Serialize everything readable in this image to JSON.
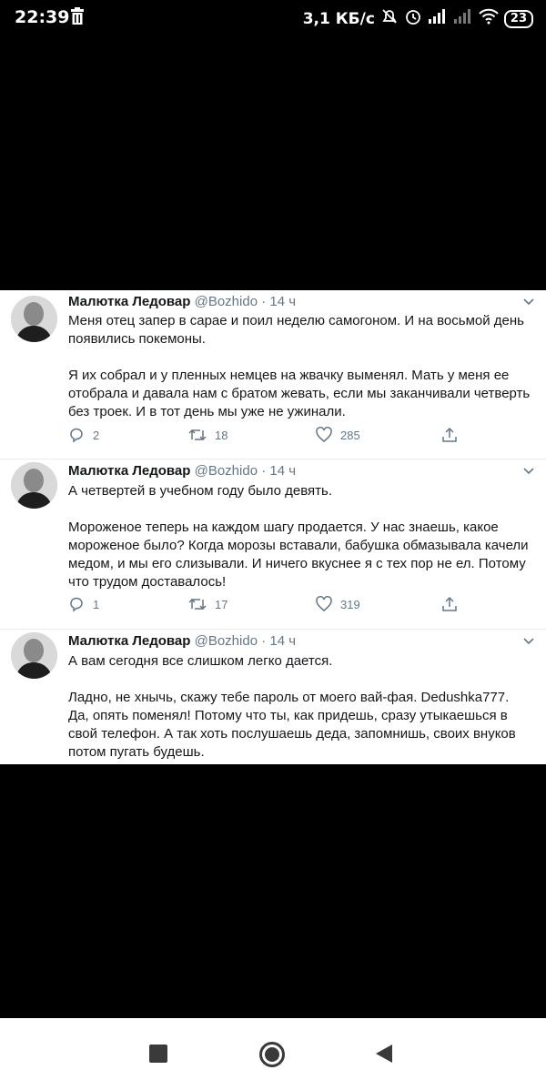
{
  "status_bar": {
    "time": "22:39",
    "network_speed": "3,1 КБ/с",
    "battery_level": "23",
    "icons": [
      "trash-icon",
      "mute-icon",
      "alarm-icon",
      "signal-icon",
      "signal-icon",
      "wifi-icon",
      "battery-icon"
    ]
  },
  "tweets": [
    {
      "author_name": "Малютка Ледовар",
      "author_handle": "@Bozhido",
      "separator": "·",
      "time": "14 ч",
      "paragraphs": [
        "Меня отец запер в сарае и поил неделю самогоном. И на восьмой день появились покемоны.",
        "Я их собрал и у пленных немцев на жвачку выменял. Мать у меня ее отобрала и давала нам с братом жевать, если мы заканчивали четверть без троек. И в тот день мы уже не ужинали."
      ],
      "replies": "2",
      "retweets": "18",
      "likes": "285"
    },
    {
      "author_name": "Малютка Ледовар",
      "author_handle": "@Bozhido",
      "separator": "·",
      "time": "14 ч",
      "paragraphs": [
        "А четвертей в учебном году было девять.",
        "Мороженое теперь на каждом шагу продается. У нас знаешь, какое мороженое было? Когда морозы вставали, бабушка обмазывала качели медом, и мы его слизывали. И ничего вкуснее я с тех пор не ел. Потому что трудом доставалось!"
      ],
      "replies": "1",
      "retweets": "17",
      "likes": "319"
    },
    {
      "author_name": "Малютка Ледовар",
      "author_handle": "@Bozhido",
      "separator": "·",
      "time": "14 ч",
      "paragraphs": [
        "А вам сегодня все слишком легко дается.",
        "Ладно, не хнычь, скажу тебе пароль от моего вай-фая. Dedushka777. Да, опять поменял! Потому что ты, как придешь, сразу утыкаешься в свой телефон. А так хоть послушаешь деда, запомнишь, своих внуков потом пугать будешь."
      ]
    }
  ],
  "colors": {
    "text": "#14171a",
    "muted": "#657786",
    "divider": "#e6ecf0",
    "background": "#000000"
  },
  "navbar": {
    "icons": [
      "recents-square-icon",
      "home-circle-icon",
      "back-triangle-icon"
    ]
  }
}
